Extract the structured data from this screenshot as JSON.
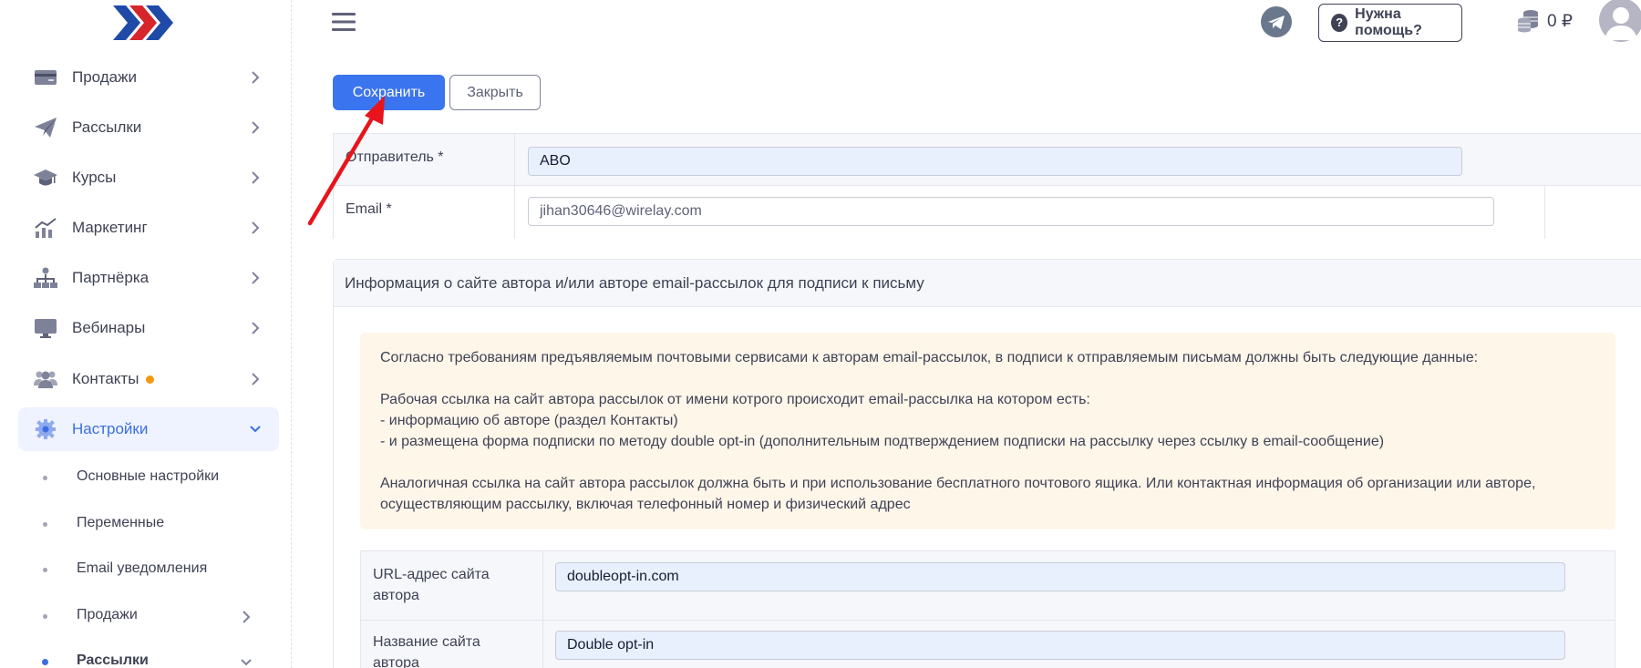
{
  "header": {
    "help_label": "Нужна помощь?",
    "balance": "0 ₽",
    "icons": [
      "menu-icon",
      "telegram-icon",
      "question-icon",
      "coins-icon",
      "avatar-icon"
    ]
  },
  "sidebar": {
    "items": [
      {
        "label": "Продажи",
        "icon": "credit-card-icon"
      },
      {
        "label": "Рассылки",
        "icon": "paper-plane-icon"
      },
      {
        "label": "Курсы",
        "icon": "graduation-cap-icon"
      },
      {
        "label": "Маркетинг",
        "icon": "chart-icon"
      },
      {
        "label": "Партнёрка",
        "icon": "sitemap-icon"
      },
      {
        "label": "Вебинары",
        "icon": "monitor-icon"
      },
      {
        "label": "Контакты",
        "icon": "users-icon"
      },
      {
        "label": "Настройки",
        "icon": "gear-icon"
      }
    ],
    "subitems": [
      {
        "label": "Основные настройки"
      },
      {
        "label": "Переменные"
      },
      {
        "label": "Email уведомления"
      },
      {
        "label": "Продажи"
      },
      {
        "label": "Рассылки"
      }
    ],
    "accent_color": "#3b6fe0",
    "badge_color": "#f29a0e"
  },
  "toolbar": {
    "save_label": "Сохранить",
    "close_label": "Закрыть"
  },
  "sender_form": {
    "sender_label": "Отправитель *",
    "sender_value": "ABO",
    "email_label": "Email *",
    "email_value": "jihan30646@wirelay.com"
  },
  "info_card": {
    "title": "Информация о сайте автора и/или авторе email-рассылок для подписи к письму",
    "notice": {
      "line1": "Согласно требованиям предъявляемым почтовыми сервисами к авторам email-рассылок, в подписи к отправляемым письмам должны быть следующие данные:",
      "line2": "Рабочая ссылка на сайт автора рассылок от имени котрого происходит email-рассылка на котором есть:",
      "line3": "- информацию об авторе (раздел Контакты)",
      "line4": "- и размещена форма подписки по методу double opt-in (дополнительным подтверждением подписки на рассылку через ссылку в email-сообщение)",
      "line5": "Аналогичная ссылка на сайт автора рассылок должна быть и при использование бесплатного почтового ящика. Или контактная информация об организации или авторе, осуществляющим рассылку, включая телефонный номер и физический адрес"
    },
    "url_label": "URL-адрес сайта автора",
    "url_value": "doubleopt-in.com",
    "site_name_label": "Название сайта автора",
    "site_name_value": "Double opt-in"
  }
}
